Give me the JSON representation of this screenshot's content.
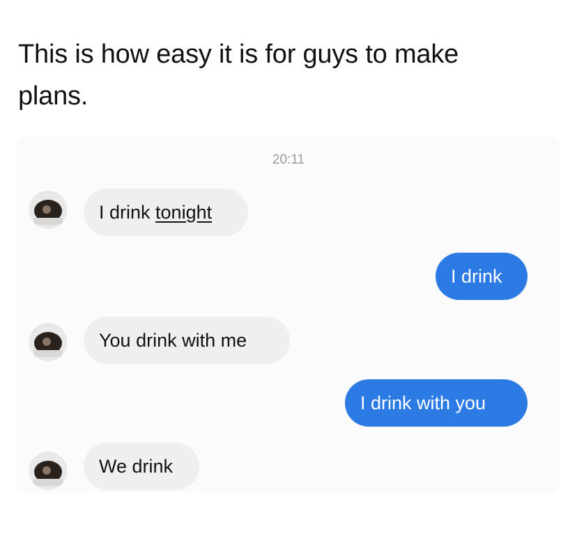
{
  "caption": "This is how easy it is for guys to make plans.",
  "chat": {
    "timestamp": "20:11",
    "messages": [
      {
        "side": "incoming",
        "text_plain": "I drink ",
        "text_underlined": "tonight"
      },
      {
        "side": "outgoing",
        "text": "I drink"
      },
      {
        "side": "incoming",
        "text": "You drink with me"
      },
      {
        "side": "outgoing",
        "text": "I drink with you"
      },
      {
        "side": "incoming",
        "text": "We drink"
      }
    ]
  },
  "colors": {
    "outgoing_bubble": "#2c7be5",
    "incoming_bubble": "#efefef",
    "timestamp": "#9a9a9a"
  }
}
